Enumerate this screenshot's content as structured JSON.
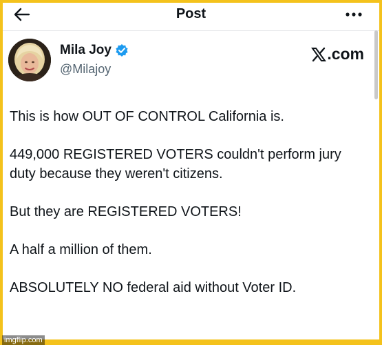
{
  "header": {
    "title": "Post",
    "back_icon": "arrow-left-icon",
    "more_icon": "more-horizontal-icon"
  },
  "post": {
    "author_name": "Mila Joy",
    "handle": "@Milajoy",
    "verified_icon": "verified-badge-icon",
    "verified_color": "#1d9bf0",
    "brand": ".com",
    "brand_icon": "x-logo-icon",
    "lines": [
      "This is how OUT OF CONTROL California is.",
      "449,000 REGISTERED VOTERS couldn't perform jury duty because they weren't citizens.",
      "But they are REGISTERED VOTERS!",
      "A half a million of them.",
      "ABSOLUTELY NO federal aid without Voter ID."
    ]
  },
  "watermark": "imgflip.com",
  "colors": {
    "frame": "#f4c21c",
    "text": "#0f1419",
    "muted": "#536471"
  }
}
